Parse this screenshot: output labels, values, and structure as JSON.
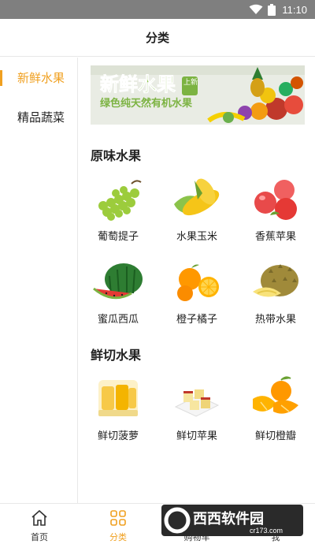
{
  "status": {
    "time": "11:10"
  },
  "header": {
    "title": "分类"
  },
  "sidebar": {
    "items": [
      {
        "label": "新鲜水果",
        "active": true
      },
      {
        "label": "精品蔬菜",
        "active": false
      }
    ]
  },
  "banner": {
    "title": "新鲜水果",
    "tag": "上新",
    "subtitle": "绿色纯天然有机水果"
  },
  "sections": [
    {
      "title": "原味水果",
      "rows": [
        [
          {
            "label": "葡萄提子",
            "icon": "grapes-icon"
          },
          {
            "label": "水果玉米",
            "icon": "corn-icon"
          },
          {
            "label": "香蕉苹果",
            "icon": "apple-icon"
          }
        ],
        [
          {
            "label": "蜜瓜西瓜",
            "icon": "watermelon-icon"
          },
          {
            "label": "橙子橘子",
            "icon": "orange-icon"
          },
          {
            "label": "热带水果",
            "icon": "durian-icon"
          }
        ]
      ]
    },
    {
      "title": "鲜切水果",
      "rows": [
        [
          {
            "label": "鲜切菠萝",
            "icon": "pineapple-cut-icon"
          },
          {
            "label": "鲜切苹果",
            "icon": "apple-cut-icon"
          },
          {
            "label": "鲜切橙瓣",
            "icon": "orange-cut-icon"
          }
        ]
      ]
    }
  ],
  "tabbar": {
    "items": [
      {
        "label": "首页",
        "icon": "home-icon",
        "active": false
      },
      {
        "label": "分类",
        "icon": "category-icon",
        "active": true
      },
      {
        "label": "购物车",
        "icon": "cart-icon",
        "active": false
      },
      {
        "label": "我",
        "icon": "profile-icon",
        "active": false
      }
    ]
  },
  "watermark": {
    "text": "西西软件园",
    "sub": "cr173.com"
  },
  "colors": {
    "accent": "#f0a020",
    "statusbar": "#7f7f7f",
    "divider": "#e8e8e8"
  }
}
